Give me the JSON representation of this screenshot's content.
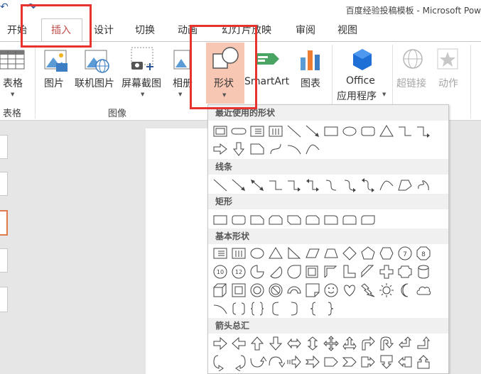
{
  "window": {
    "title": "百度经验投稿模板 - Microsoft Pow"
  },
  "tabs": [
    "开始",
    "插入",
    "设计",
    "切换",
    "动画",
    "幻灯片放映",
    "审阅",
    "视图"
  ],
  "active_tab": "插入",
  "ribbon": {
    "tables": {
      "button": "表格",
      "group": "表格"
    },
    "images": {
      "picture": "图片",
      "online_picture": "联机图片",
      "screenshot": "屏幕截图",
      "album": "相册",
      "group": "图像"
    },
    "illustrations": {
      "shapes": "形状",
      "smartart": "SmartArt",
      "chart": "图表"
    },
    "office_apps": {
      "line1": "Office",
      "line2": "应用程序"
    },
    "links": {
      "hyperlink": "超链接",
      "action": "动作"
    }
  },
  "shape_menu": {
    "sections": [
      {
        "title": "最近使用的形状"
      },
      {
        "title": "线条"
      },
      {
        "title": "矩形"
      },
      {
        "title": "基本形状"
      },
      {
        "title": "箭头总汇"
      }
    ],
    "numbered_shapes": [
      "7",
      "8",
      "10",
      "12"
    ]
  },
  "colors": {
    "accent_red": "#e8322d",
    "active_tab_text": "#c0504d",
    "shapes_button_bg": "#f8c7b4"
  }
}
